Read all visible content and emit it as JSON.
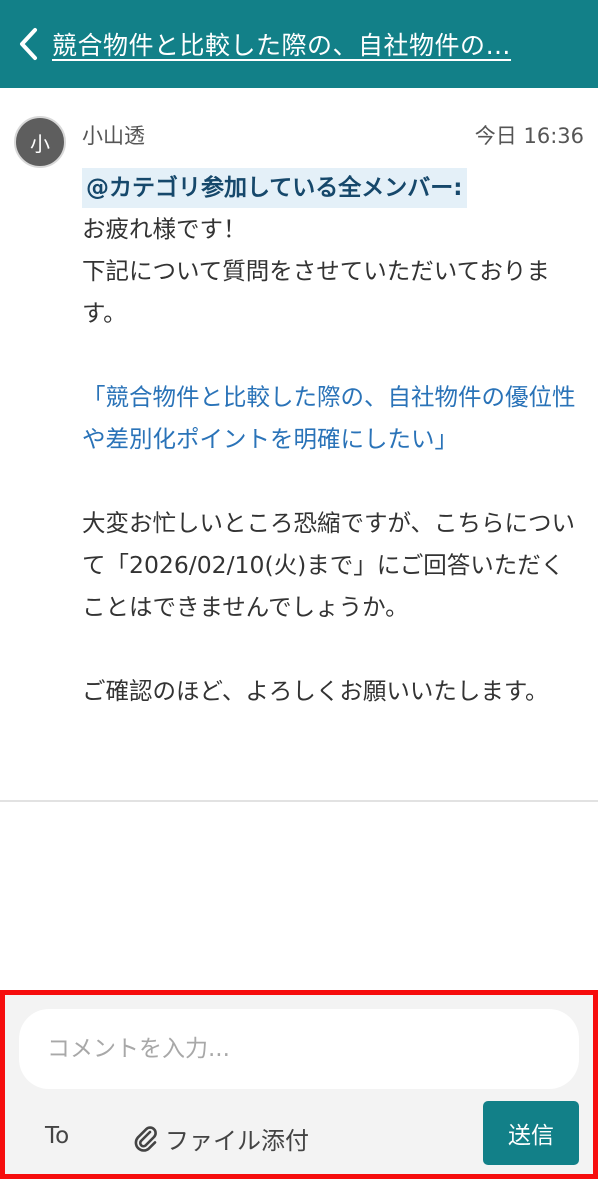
{
  "header": {
    "title": "競合物件と比較した際の、自社物件の…",
    "back_icon": "chevron-left-icon"
  },
  "post": {
    "avatar_initial": "小",
    "author": "小山透",
    "timestamp": "今日 16:36",
    "mention": "@カテゴリ参加している全メンバー:",
    "greeting": "お疲れ様です！\n下記について質問をさせていただいております。",
    "quote": "「競合物件と比較した際の、自社物件の優位性や差別化ポイントを明確にしたい」",
    "request": "大変お忙しいところ恐縮ですが、こちらについて「2026/02/10(火)まで」にご回答いただくことはできませんでしょうか。",
    "closing": "ご確認のほど、よろしくお願いいたします。"
  },
  "composer": {
    "placeholder": "コメントを入力...",
    "value": "",
    "to_label": "To",
    "attach_label": "ファイル添付",
    "attach_icon": "paperclip-icon",
    "send_label": "送信"
  },
  "colors": {
    "brand": "#128088",
    "mention_bg": "#e4f0f8",
    "quote_text": "#2a73b8",
    "highlight_border": "#f60d0d"
  }
}
